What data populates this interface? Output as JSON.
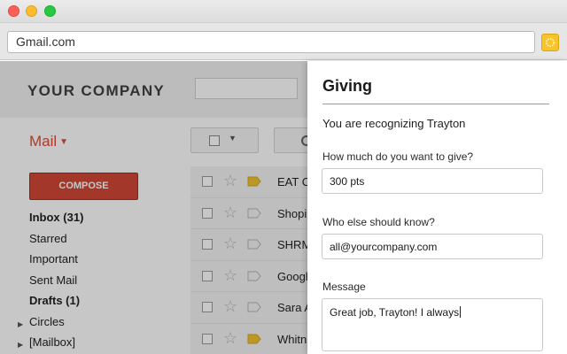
{
  "browser": {
    "url": "Gmail.com",
    "extension_icon": "sun-icon",
    "extension_color": "#f7c52b"
  },
  "gmail": {
    "brand": "YOUR COMPANY",
    "mail_label": "Mail",
    "compose_label": "COMPOSE",
    "folders": [
      {
        "label": "Inbox (31)",
        "bold": true
      },
      {
        "label": "Starred",
        "bold": false
      },
      {
        "label": "Important",
        "bold": false
      },
      {
        "label": "Sent Mail",
        "bold": false
      },
      {
        "label": "Drafts (1)",
        "bold": true
      },
      {
        "label": "Circles",
        "bold": false,
        "expandable": true
      },
      {
        "label": "[Mailbox]",
        "bold": false,
        "expandable": true
      }
    ],
    "messages": [
      {
        "sender": "EAT C",
        "important": true
      },
      {
        "sender": "Shopi",
        "important": false
      },
      {
        "sender": "SHRM",
        "important": false
      },
      {
        "sender": "Googl",
        "important": false
      },
      {
        "sender": "Sara A",
        "important": false
      },
      {
        "sender": "Whitn",
        "important": true
      }
    ]
  },
  "panel": {
    "title": "Giving",
    "subtitle": "You are recognizing Trayton",
    "amount_label": "How much do you want to give?",
    "amount_value": "300 pts",
    "notify_label": "Who else should know?",
    "notify_value": "all@yourcompany.com",
    "message_label": "Message",
    "message_value": "Great job, Trayton! I always"
  },
  "colors": {
    "compose": "#d14836",
    "mail_label": "#dd4b39",
    "important_tag": "#f0c330"
  }
}
